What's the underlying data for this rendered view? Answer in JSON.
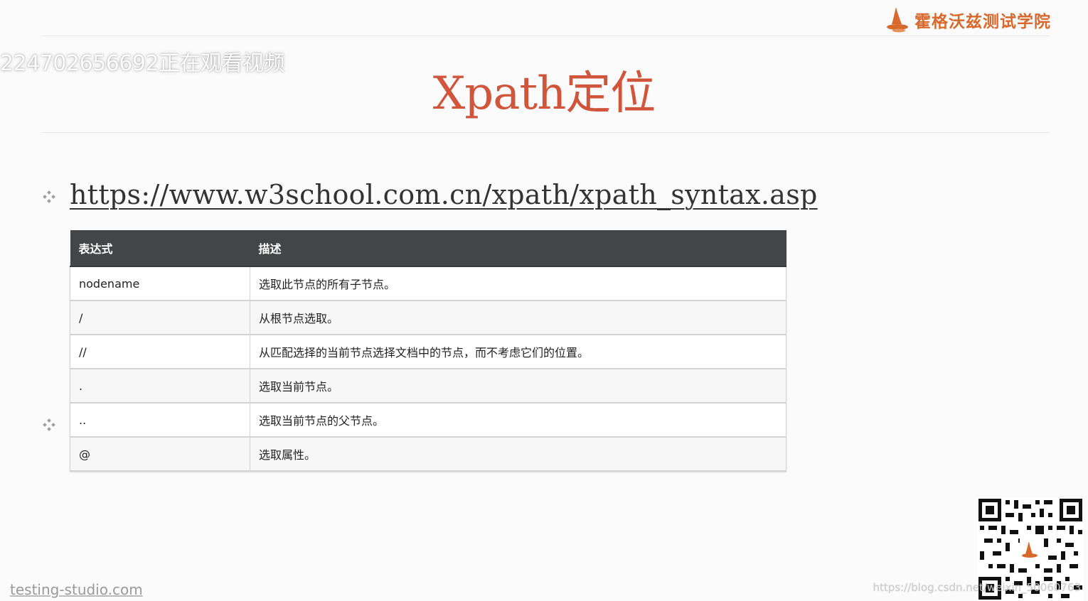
{
  "overlay": {
    "watching_text": "224702656692正在观看视频"
  },
  "brand": {
    "logo_text": "霍格沃兹测试学院",
    "accent_color": "#d8692c"
  },
  "slide": {
    "title": "Xpath定位",
    "title_color": "#d0553a",
    "link_url": "https://www.w3school.com.cn/xpath/xpath_syntax.asp"
  },
  "table": {
    "headers": [
      "表达式",
      "描述"
    ],
    "rows": [
      {
        "expr": "nodename",
        "desc": "选取此节点的所有子节点。"
      },
      {
        "expr": "/",
        "desc": "从根节点选取。"
      },
      {
        "expr": "//",
        "desc": "从匹配选择的当前节点选择文档中的节点，而不考虑它们的位置。"
      },
      {
        "expr": ".",
        "desc": "选取当前节点。"
      },
      {
        "expr": "..",
        "desc": "选取当前节点的父节点。"
      },
      {
        "expr": "@",
        "desc": "选取属性。"
      }
    ]
  },
  "footer": {
    "site": "testing-studio.com",
    "csdn_watermark": "https://blog.csdn.net/weixin_50060763"
  },
  "icons": {
    "bullet": "diamond-cluster-bullet-icon",
    "logo": "wizard-hat-logo-icon",
    "qr": "qr-code-icon"
  }
}
